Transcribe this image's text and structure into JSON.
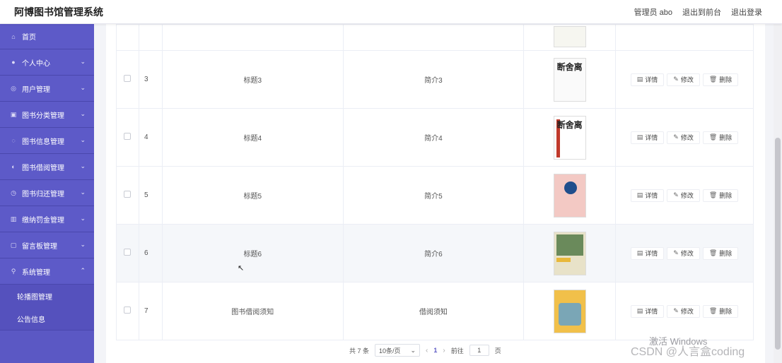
{
  "header": {
    "app_title": "阿博图书馆管理系统",
    "admin_label": "管理员 abo",
    "goto_front": "退出到前台",
    "logout": "退出登录"
  },
  "sidebar": {
    "items": [
      {
        "label": "首页",
        "icon": "home-icon"
      },
      {
        "label": "个人中心",
        "icon": "user-icon"
      },
      {
        "label": "用户管理",
        "icon": "users-icon"
      },
      {
        "label": "图书分类管理",
        "icon": "category-icon"
      },
      {
        "label": "图书信息管理",
        "icon": "book-info-icon"
      },
      {
        "label": "图书借阅管理",
        "icon": "borrow-icon"
      },
      {
        "label": "图书归还管理",
        "icon": "return-icon"
      },
      {
        "label": "缴纳罚金管理",
        "icon": "fine-icon"
      },
      {
        "label": "留言板管理",
        "icon": "message-icon"
      },
      {
        "label": "系统管理",
        "icon": "system-icon"
      }
    ],
    "subitems": [
      {
        "label": "轮播图管理"
      },
      {
        "label": "公告信息"
      }
    ]
  },
  "table": {
    "rows": [
      {
        "index": "3",
        "title": "标题3",
        "intro": "简介3",
        "cover": "断舍离"
      },
      {
        "index": "4",
        "title": "标题4",
        "intro": "简介4",
        "cover": "断舍离"
      },
      {
        "index": "5",
        "title": "标题5",
        "intro": "简介5",
        "cover": ""
      },
      {
        "index": "6",
        "title": "标题6",
        "intro": "简介6",
        "cover": ""
      },
      {
        "index": "7",
        "title": "图书借阅须知",
        "intro": "借阅须知",
        "cover": ""
      }
    ],
    "actions": {
      "detail": "详情",
      "edit": "修改",
      "delete": "删除"
    }
  },
  "pagination": {
    "total": "共 7 条",
    "page_size": "10条/页",
    "current_page": "1",
    "goto_label": "前往",
    "goto_value": "1",
    "page_suffix": "页"
  },
  "watermark": {
    "windows": "激活 Windows",
    "csdn": "CSDN @人言盒coding"
  },
  "colors": {
    "sidebar": "#5b58c4",
    "accent": "#5b58c4"
  }
}
